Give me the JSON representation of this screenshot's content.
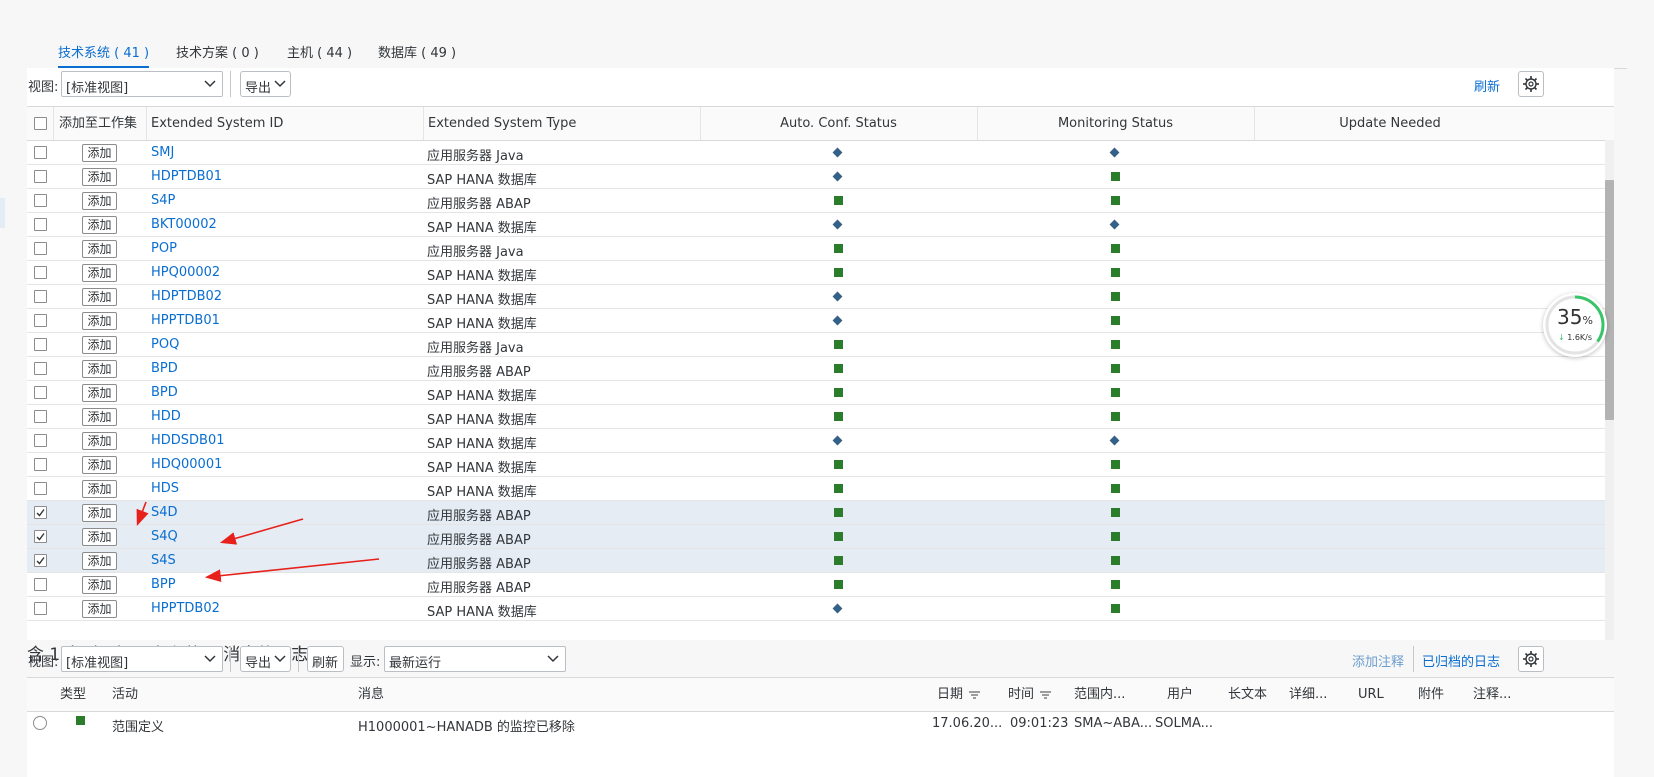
{
  "tabs": [
    {
      "label": "技术系统 ( 41 )",
      "active": true
    },
    {
      "label": "技术方案 ( 0 )",
      "active": false
    },
    {
      "label": "主机 ( 44 )",
      "active": false
    },
    {
      "label": "数据库 ( 49 )",
      "active": false
    }
  ],
  "toolbar": {
    "view_label": "视图:",
    "view_value": "[标准视图]",
    "export_label": "导出",
    "refresh_label": "刷新"
  },
  "table": {
    "columns": [
      "添加至工作集",
      "Extended System ID",
      "Extended System Type",
      "Auto. Conf. Status",
      "Monitoring Status",
      "Update Needed"
    ],
    "add_label": "添加",
    "rows": [
      {
        "id": "SMJ",
        "type": "应用服务器 Java",
        "auto": "diamond",
        "mon": "diamond",
        "checked": false
      },
      {
        "id": "HDPTDB01",
        "type": "SAP HANA 数据库",
        "auto": "diamond",
        "mon": "square",
        "checked": false
      },
      {
        "id": "S4P",
        "type": "应用服务器 ABAP",
        "auto": "square",
        "mon": "square",
        "checked": false
      },
      {
        "id": "BKT00002",
        "type": "SAP HANA 数据库",
        "auto": "diamond",
        "mon": "diamond",
        "checked": false
      },
      {
        "id": "POP",
        "type": "应用服务器 Java",
        "auto": "square",
        "mon": "square",
        "checked": false
      },
      {
        "id": "HPQ00002",
        "type": "SAP HANA 数据库",
        "auto": "square",
        "mon": "square",
        "checked": false
      },
      {
        "id": "HDPTDB02",
        "type": "SAP HANA 数据库",
        "auto": "diamond",
        "mon": "square",
        "checked": false
      },
      {
        "id": "HPPTDB01",
        "type": "SAP HANA 数据库",
        "auto": "diamond",
        "mon": "square",
        "checked": false
      },
      {
        "id": "POQ",
        "type": "应用服务器 Java",
        "auto": "square",
        "mon": "square",
        "checked": false
      },
      {
        "id": "BPD",
        "type": "应用服务器 ABAP",
        "auto": "square",
        "mon": "square",
        "checked": false
      },
      {
        "id": "BPD",
        "type": "SAP HANA 数据库",
        "auto": "square",
        "mon": "square",
        "checked": false
      },
      {
        "id": "HDD",
        "type": "SAP HANA 数据库",
        "auto": "square",
        "mon": "square",
        "checked": false
      },
      {
        "id": "HDDSDB01",
        "type": "SAP HANA 数据库",
        "auto": "diamond",
        "mon": "diamond",
        "checked": false
      },
      {
        "id": "HDQ00001",
        "type": "SAP HANA 数据库",
        "auto": "square",
        "mon": "square",
        "checked": false
      },
      {
        "id": "HDS",
        "type": "SAP HANA 数据库",
        "auto": "square",
        "mon": "square",
        "checked": false
      },
      {
        "id": "S4D",
        "type": "应用服务器 ABAP",
        "auto": "square",
        "mon": "square",
        "checked": true
      },
      {
        "id": "S4Q",
        "type": "应用服务器 ABAP",
        "auto": "square",
        "mon": "square",
        "checked": true
      },
      {
        "id": "S4S",
        "type": "应用服务器 ABAP",
        "auto": "square",
        "mon": "square",
        "checked": true
      },
      {
        "id": "BPP",
        "type": "应用服务器 ABAP",
        "auto": "square",
        "mon": "square",
        "checked": false
      },
      {
        "id": "HPPTDB02",
        "type": "SAP HANA 数据库",
        "auto": "diamond",
        "mon": "square",
        "checked": false
      }
    ]
  },
  "log": {
    "title": "含 1 条 为 步骤 定义范围 消息的日志",
    "view_label": "视图:",
    "view_value": "[标准视图]",
    "export_label": "导出",
    "refresh_label": "刷新",
    "show_label": "显示:",
    "show_value": "最新运行",
    "add_note": "添加注释",
    "archived_log": "已归档的日志",
    "columns": [
      "类型",
      "活动",
      "消息",
      "日期",
      "时间",
      "范围内...",
      "用户",
      "长文本",
      "详细...",
      "URL",
      "附件",
      "注释..."
    ],
    "row": {
      "activity": "范围定义",
      "message": "H1000001~HANADB 的监控已移除",
      "date": "17.06.20...",
      "time": "09:01:23",
      "scope": "SMA~ABA...",
      "user": "SOLMA..."
    }
  },
  "speed_widget": {
    "percent": "35",
    "percent_sign": "%",
    "rate": "1.6K/s"
  },
  "colors": {
    "link": "#0a6ed1",
    "status_green": "#2b7d2b",
    "status_blue": "#346187",
    "annotation_arrow": "#e8201b"
  }
}
